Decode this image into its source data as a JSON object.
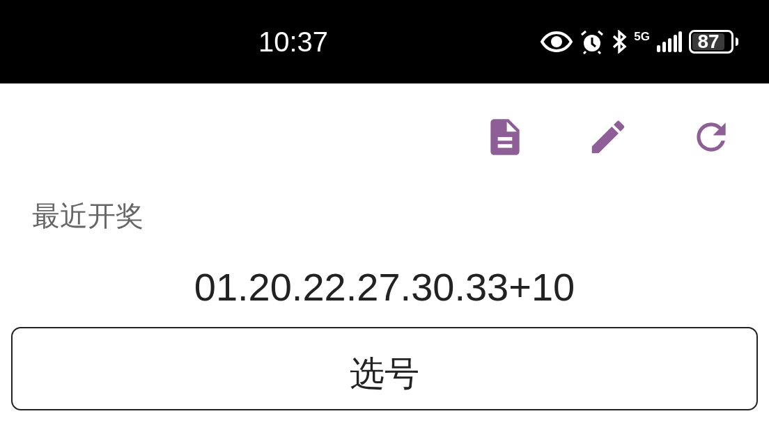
{
  "status_bar": {
    "time": "10:37",
    "network": "5G",
    "battery": "87"
  },
  "toolbar": {
    "actions": [
      {
        "kind": "document"
      },
      {
        "kind": "edit"
      },
      {
        "kind": "refresh"
      }
    ]
  },
  "section_label": "最近开奖",
  "latest_draw": "01.20.22.27.30.33+10",
  "pick_button": {
    "label": "选号"
  }
}
